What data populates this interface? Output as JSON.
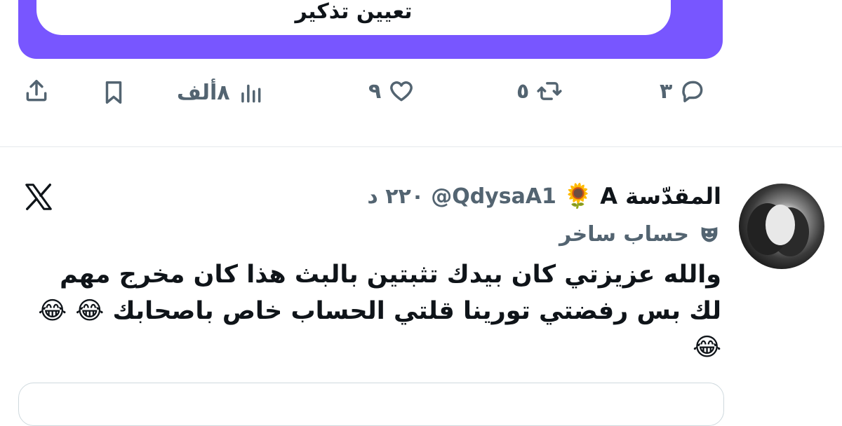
{
  "promo": {
    "button_label": "تعيين تذكير"
  },
  "actions": {
    "replies": "٣",
    "reposts": "٥",
    "likes": "٩",
    "views": "٨ألف"
  },
  "tweet": {
    "display_name": "المقدّسة A",
    "emoji": "🌻",
    "handle": "@QdysaA1",
    "time": "٢٢٠ د",
    "label": "حساب ساخر",
    "text": "والله عزيزتي كان بيدك تثبتين بالبث هذا كان مخرج مهم لك بس رفضتي تورينا قلتي الحساب خاص باصحابك 😂 😂😂"
  },
  "icons": {
    "reply": "reply-icon",
    "repost": "repost-icon",
    "like": "heart-icon",
    "views": "views-icon",
    "bookmark": "bookmark-icon",
    "share": "share-icon",
    "x_logo": "x-logo-icon",
    "parody": "mask-icon"
  },
  "colors": {
    "accent": "#7856ff",
    "muted": "#536471"
  }
}
